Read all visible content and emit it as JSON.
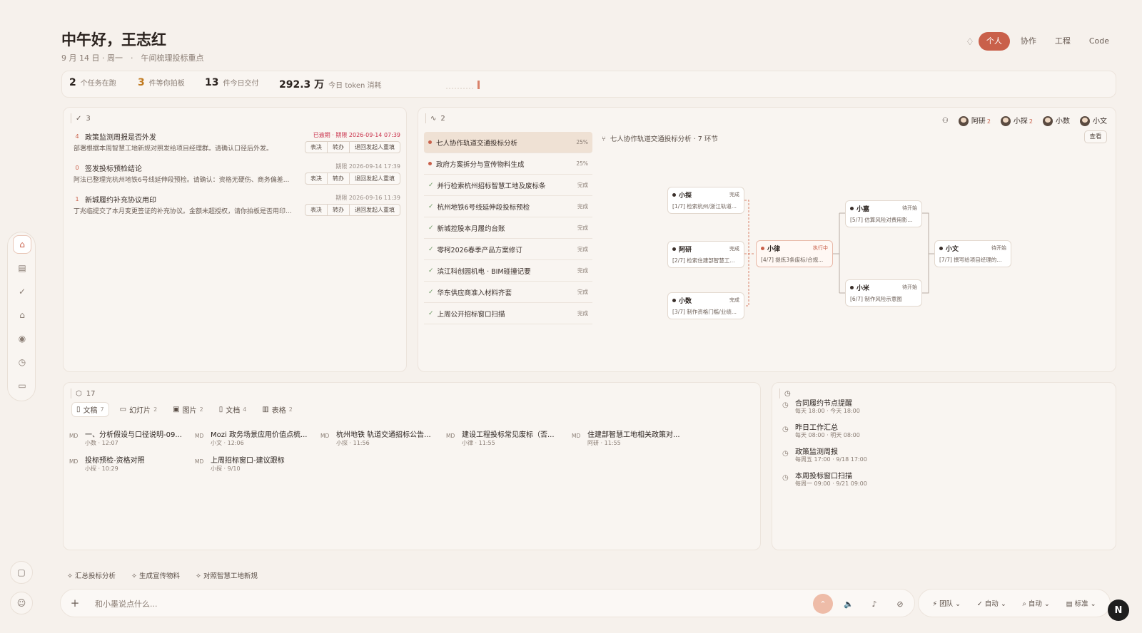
{
  "header": {
    "greeting": "中午好，王志红",
    "date": "9 月 14 日 · 周一",
    "hint": "午间梳理投标重点"
  },
  "mode_tabs": [
    "个人",
    "协作",
    "工程",
    "Code"
  ],
  "stats": [
    {
      "n": "2",
      "l": "个任务在跑"
    },
    {
      "n": "3",
      "l": "件等你拍板"
    },
    {
      "n": "13",
      "l": "件今日交付"
    },
    {
      "n": "292.3 万",
      "l": "今日 token 消耗"
    }
  ],
  "todo": {
    "count": "3",
    "items": [
      {
        "idx": "4",
        "title": "政策监测周报是否外发",
        "due": "已逾期 · 期限 2026-09-14 07:39",
        "desc": "部署根据本周智慧工地新规对照发给项目经理群。请确认口径后外发。"
      },
      {
        "idx": "0",
        "title": "签发投标预检结论",
        "due": "期限 2026-09-14 17:39",
        "desc": "阿法已整理完杭州地铁6号线延伸段预检。请确认：资格无硬伤、商务偏差..."
      },
      {
        "idx": "1",
        "title": "新城履约补充协议用印",
        "due": "期限 2026-09-16 11:39",
        "desc": "丁兆临提交了本月变更签证的补充协议。金额未超授权，请你拍板是否用印..."
      }
    ],
    "buttons": [
      "表决",
      "转办",
      "退回发起人重填"
    ]
  },
  "workflow": {
    "count": "2",
    "title": "七人协作轨道交通投标分析 · 7 环节",
    "view": "查看",
    "people": [
      {
        "n": "阿研",
        "c": "2"
      },
      {
        "n": "小探",
        "c": "2"
      },
      {
        "n": "小数",
        "c": ""
      },
      {
        "n": "小文",
        "c": ""
      }
    ],
    "tasks": [
      {
        "t": "七人协作轨道交通投标分析",
        "s": "25%",
        "state": "run"
      },
      {
        "t": "政府方案拆分与宣传物料生成",
        "s": "25%",
        "state": "run"
      },
      {
        "t": "并行检索杭州招标智慧工地及废标条",
        "s": "完成",
        "state": "done"
      },
      {
        "t": "杭州地铁6号线延伸段投标预检",
        "s": "完成",
        "state": "done"
      },
      {
        "t": "新城控股本月履约台账",
        "s": "完成",
        "state": "done"
      },
      {
        "t": "零柯2026春季产品方案修订",
        "s": "完成",
        "state": "done"
      },
      {
        "t": "滨江科创园机电 · BIM碰撞记要",
        "s": "完成",
        "state": "done"
      },
      {
        "t": "华东供应商准入材料齐套",
        "s": "完成",
        "state": "done"
      },
      {
        "t": "上周公开招标窗口扫描",
        "s": "完成",
        "state": "done"
      }
    ],
    "nodes": [
      {
        "n": "小探",
        "s": "完成",
        "d": "[1/7] 检索杭州/浙江轨道..."
      },
      {
        "n": "阿研",
        "s": "完成",
        "d": "[2/7] 检索住建部智慧工..."
      },
      {
        "n": "小数",
        "s": "完成",
        "d": "[3/7] 制作资格门槛/业绩..."
      },
      {
        "n": "小律",
        "s": "执行中",
        "d": "[4/7] 提炼3条废标/合规..."
      },
      {
        "n": "小嘉",
        "s": "待开始",
        "d": "[5/7] 估算风险对费用影..."
      },
      {
        "n": "小米",
        "s": "待开始",
        "d": "[6/7] 制作风险示意图"
      },
      {
        "n": "小文",
        "s": "待开始",
        "d": "[7/7] 撰写给项目经理的..."
      }
    ]
  },
  "artifacts": {
    "count": "17",
    "tabs": [
      {
        "l": "文稿",
        "c": "7"
      },
      {
        "l": "幻灯片",
        "c": "2"
      },
      {
        "l": "图片",
        "c": "2"
      },
      {
        "l": "文档",
        "c": "4"
      },
      {
        "l": "表格",
        "c": "2"
      }
    ],
    "files": [
      {
        "t": "一、分析假设与口径说明-09...",
        "m": "小数 · 12:07"
      },
      {
        "t": "Mozi 政务场景应用价值点梳...",
        "m": "小文 · 12:06"
      },
      {
        "t": "杭州地铁 轨道交通招标公告...",
        "m": "小探 · 11:56"
      },
      {
        "t": "建设工程投标常见废标（否...",
        "m": "小律 · 11:55"
      },
      {
        "t": "住建部智慧工地相关政策对...",
        "m": "阿研 · 11:55"
      },
      {
        "t": "投标预检-资格对照",
        "m": "小探 · 10:29"
      },
      {
        "t": "上周招标窗口-建议跟标",
        "m": "小探 · 9/10"
      }
    ],
    "md": "MD"
  },
  "schedules": [
    {
      "t": "合同履约节点提醒",
      "m": "每天 18:00 · 今天 18:00"
    },
    {
      "t": "昨日工作汇总",
      "m": "每天 08:00 · 明天 08:00"
    },
    {
      "t": "政策监测周报",
      "m": "每周五 17:00 · 9/18 17:00"
    },
    {
      "t": "本周投标窗口扫描",
      "m": "每周一 09:00 · 9/21 09:00"
    }
  ],
  "chips": [
    "汇总投标分析",
    "生成宣传物料",
    "对照智慧工地新规"
  ],
  "composer": {
    "placeholder": "和小墨说点什么..."
  },
  "right_tools": [
    "团队",
    "自动",
    "自动",
    "标准"
  ],
  "avatar_letter": "N"
}
